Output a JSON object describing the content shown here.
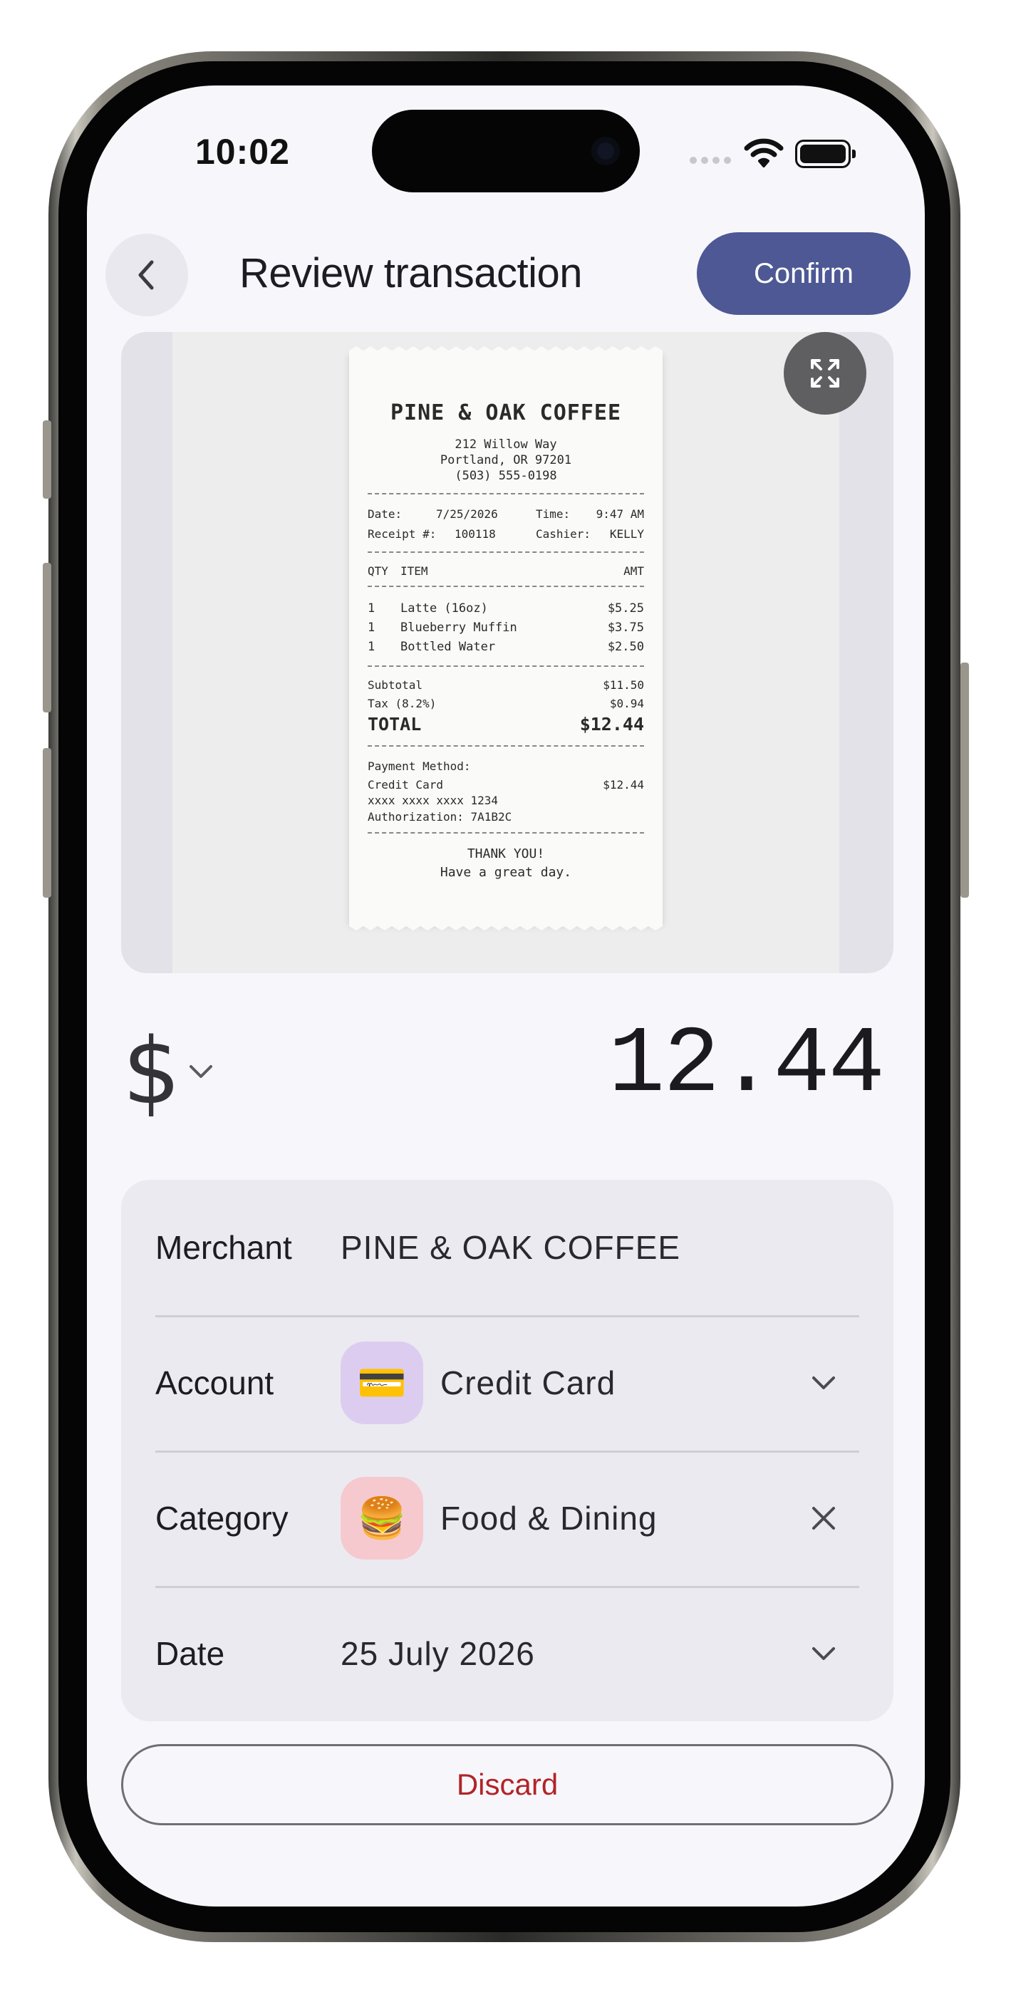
{
  "status_bar": {
    "time": "10:02"
  },
  "header": {
    "title": "Review transaction",
    "confirm_label": "Confirm"
  },
  "receipt": {
    "store": "PINE & OAK COFFEE",
    "address_1": "212 Willow Way",
    "address_2": "Portland, OR 97201",
    "phone": "(503) 555-0198",
    "date_label": "Date:",
    "date": "7/25/2026",
    "time_label": "Time:",
    "time": "9:47 AM",
    "receipt_label": "Receipt #:",
    "receipt_no": "100118",
    "cashier_label": "Cashier:",
    "cashier": "KELLY",
    "col_qty": "QTY",
    "col_item": "ITEM",
    "col_amt": "AMT",
    "items": [
      {
        "qty": "1",
        "name": "Latte (16oz)",
        "amt": "$5.25"
      },
      {
        "qty": "1",
        "name": "Blueberry Muffin",
        "amt": "$3.75"
      },
      {
        "qty": "1",
        "name": "Bottled Water",
        "amt": "$2.50"
      }
    ],
    "subtotal_label": "Subtotal",
    "subtotal": "$11.50",
    "tax_label": "Tax (8.2%)",
    "tax": "$0.94",
    "total_label": "TOTAL",
    "total": "$12.44",
    "payment_label": "Payment Method:",
    "payment_method": "Credit Card",
    "payment_amount": "$12.44",
    "card_number": "xxxx xxxx xxxx 1234",
    "authorization": "Authorization: 7A1B2C",
    "thanks": "THANK YOU!",
    "farewell": "Have a great day."
  },
  "amount": {
    "currency_symbol": "$",
    "value": "12.44"
  },
  "details": {
    "merchant_label": "Merchant",
    "merchant_value": "PINE & OAK COFFEE",
    "account_label": "Account",
    "account_value": "Credit Card",
    "account_icon": "credit-card-emoji",
    "account_icon_glyph": "💳",
    "category_label": "Category",
    "category_value": "Food & Dining",
    "category_icon": "hamburger-emoji",
    "category_icon_glyph": "🍔",
    "date_label": "Date",
    "date_value": "25 July 2026"
  },
  "colors": {
    "confirm": "#4d5894",
    "discard_text": "#b02428",
    "account_icon_bg": "#dccdf0",
    "category_icon_bg": "#f6c9cf"
  },
  "discard_label": "Discard"
}
